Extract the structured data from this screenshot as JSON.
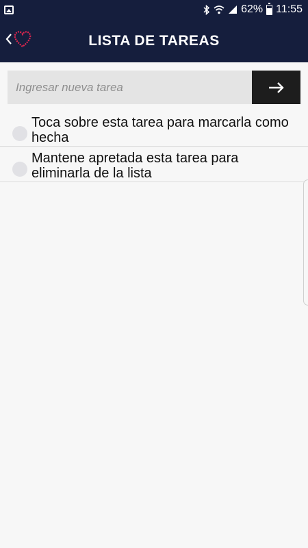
{
  "status_bar": {
    "battery_percent": "62%",
    "time": "11:55",
    "icons": [
      "gallery-icon",
      "bluetooth-icon",
      "wifi-icon",
      "signal-icon",
      "battery-icon"
    ]
  },
  "header": {
    "title": "LISTA DE TAREAS",
    "back_icon": "chevron-left-icon",
    "logo": "heart-logo",
    "background": "#151e3d",
    "logo_color": "#e0264f"
  },
  "new_task": {
    "placeholder": "Ingresar nueva tarea",
    "value": "",
    "submit_icon": "arrow-right-icon"
  },
  "tasks": [
    {
      "text": "Toca sobre esta tarea para marcarla como hecha",
      "done": false
    },
    {
      "text": "Mantene apretada esta tarea para eliminarla de la lista",
      "done": false
    }
  ]
}
